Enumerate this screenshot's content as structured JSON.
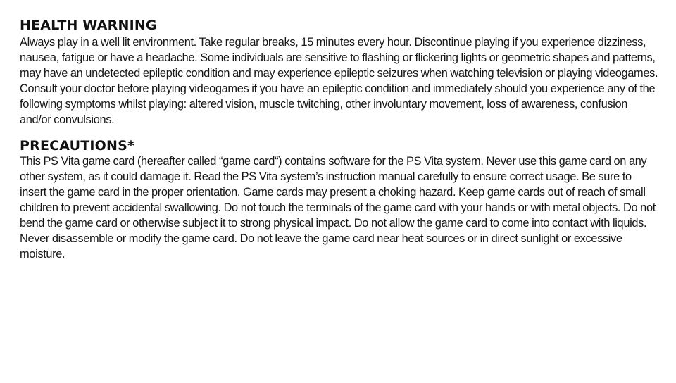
{
  "health_warning": {
    "heading": "HEALTH WARNING",
    "body": "Always play in a well lit environment. Take regular breaks, 15 minutes every hour. Discontinue playing if you experience dizziness, nausea, fatigue or have a headache. Some individuals are sensitive to flashing or flickering lights or geometric shapes and patterns, may have an undetected epileptic condition and may experience epileptic seizures when watching television or playing videogames. Consult your doctor before playing videogames if you have an epileptic condition and immediately should you experience any of the following symptoms whilst playing: altered vision, muscle twitching, other involuntary movement, loss of awareness, confusion and/or convulsions."
  },
  "precautions": {
    "heading": "PRECAUTIONS*",
    "body": "This PS Vita game card (hereafter called “game card“) contains software for the PS Vita system. Never use this game card on any other system, as it could damage it. Read the PS Vita system’s instruction manual carefully to ensure correct usage. Be sure to insert the game card in the proper orientation. Game cards may present a choking hazard. Keep game cards out of reach of small children to prevent accidental swallowing. Do not touch the terminals of the game card with your hands or with metal objects. Do not bend the game card or otherwise subject it to strong physical impact. Do not allow the game card to come into contact with liquids. Never disassemble or modify the game card. Do not leave the game card near heat sources or in direct sunlight or excessive moisture."
  }
}
